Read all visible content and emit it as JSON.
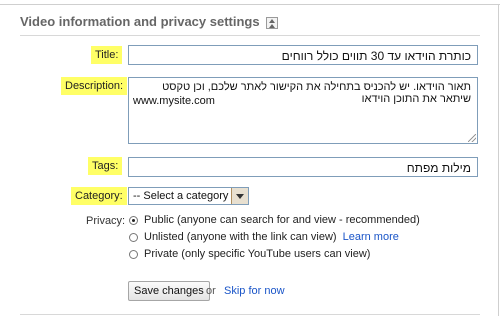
{
  "section": {
    "title": "Video information and privacy settings"
  },
  "fields": {
    "title_label": "Title:",
    "title_value": "כותרת הוידאו עד 30 תווים כולל רווחים",
    "description_label": "Description:",
    "description_line1": "תאור הוידאו. יש להכניס בתחילה את הקישור לאתר שלכם, וכן טקסט שיתאר את התוכן הוידאו",
    "description_line2": "www.mysite.com",
    "tags_label": "Tags:",
    "tags_value": "מילות מפתח",
    "category_label": "Category:",
    "category_selected": "-- Select a category --"
  },
  "privacy": {
    "label": "Privacy:",
    "options": [
      {
        "text": "Public (anyone can search for and view - recommended)",
        "selected": true
      },
      {
        "text": "Unlisted (anyone with the link can view)",
        "link": "Learn more",
        "selected": false
      },
      {
        "text": "Private (only specific YouTube users can view)",
        "selected": false
      }
    ]
  },
  "actions": {
    "save_label": "Save changes",
    "or_text": "or",
    "skip_label": "Skip for now"
  },
  "colors": {
    "highlight": "#ffff66",
    "link": "#1a55c8",
    "field_border": "#7f9db9"
  }
}
